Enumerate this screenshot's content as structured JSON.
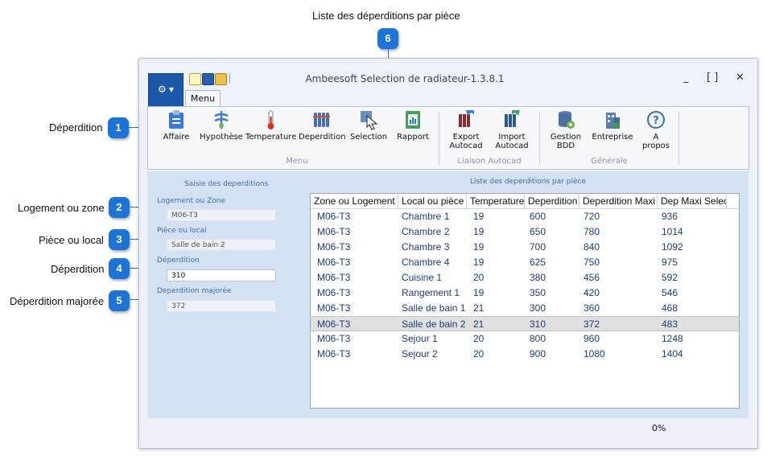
{
  "annotations": {
    "top_label": "Liste des déperditions par pièce",
    "items": [
      {
        "number": "1",
        "label": "Déperdition"
      },
      {
        "number": "2",
        "label": "Logement ou zone"
      },
      {
        "number": "3",
        "label": "Pièce ou local"
      },
      {
        "number": "4",
        "label": "Déperdition"
      },
      {
        "number": "5",
        "label": "Déperdition majorée"
      },
      {
        "number": "6"
      }
    ]
  },
  "window": {
    "title": "Ambeesoft Selection de radiateur-1.3.8.1",
    "controls": {
      "minimize": "_",
      "maximize": "[ ]",
      "close": "✕"
    },
    "tab": "Menu"
  },
  "ribbon": {
    "groups": [
      {
        "label": "Menu",
        "buttons": [
          {
            "label": "Affaire",
            "icon": "clipboard-icon"
          },
          {
            "label": "Hypothèse",
            "icon": "hypothesis-icon"
          },
          {
            "label": "Temperature",
            "icon": "thermometer-icon"
          },
          {
            "label": "Deperdition",
            "icon": "radiator-icon"
          },
          {
            "label": "Selection",
            "icon": "selection-cursor-icon"
          },
          {
            "label": "Rapport",
            "icon": "report-icon"
          }
        ]
      },
      {
        "label": "Liaison Autocad",
        "buttons": [
          {
            "label": "Export Autocad",
            "line1": "Export",
            "line2": "Autocad",
            "icon": "export-autocad-icon"
          },
          {
            "label": "Import Autocad",
            "line1": "Import",
            "line2": "Autocad",
            "icon": "import-autocad-icon"
          }
        ]
      },
      {
        "label": "Générale",
        "buttons": [
          {
            "label": "Gestion BDD",
            "line1": "Gestion",
            "line2": "BDD",
            "icon": "database-gear-icon"
          },
          {
            "label": "Entreprise",
            "icon": "building-icon"
          },
          {
            "label": "A propos",
            "line1": "A",
            "line2": "propos",
            "icon": "help-icon"
          }
        ]
      }
    ]
  },
  "left_pane": {
    "title": "Saisie des deperditions",
    "fields": [
      {
        "label": "Logement ou Zone",
        "value": "M06-T3"
      },
      {
        "label": "Pièce ou local",
        "value": "Salle de bain 2"
      },
      {
        "label": "Déperdition",
        "value": "310"
      },
      {
        "label": "Deperdition majorée",
        "value": "372"
      }
    ]
  },
  "right_pane": {
    "title": "Liste des deperditions par pièce",
    "columns": [
      "Zone ou Logement",
      "Local ou pièce",
      "Temperature",
      "Deperdition",
      "Deperdition Maxi",
      "Dep Maxi Selec"
    ],
    "rows": [
      [
        "M06-T3",
        "Chambre 1",
        "19",
        "600",
        "720",
        "936"
      ],
      [
        "M06-T3",
        "Chambre 2",
        "19",
        "650",
        "780",
        "1014"
      ],
      [
        "M06-T3",
        "Chambre 3",
        "19",
        "700",
        "840",
        "1092"
      ],
      [
        "M06-T3",
        "Chambre 4",
        "19",
        "625",
        "750",
        "975"
      ],
      [
        "M06-T3",
        "Cuisine 1",
        "20",
        "380",
        "456",
        "592"
      ],
      [
        "M06-T3",
        "Rangement 1",
        "19",
        "350",
        "420",
        "546"
      ],
      [
        "M06-T3",
        "Salle de bain 1",
        "21",
        "300",
        "360",
        "468"
      ],
      [
        "M06-T3",
        "Salle de bain 2",
        "21",
        "310",
        "372",
        "483"
      ],
      [
        "M06-T3",
        "Sejour 1",
        "20",
        "800",
        "960",
        "1248"
      ],
      [
        "M06-T3",
        "Sejour 2",
        "20",
        "900",
        "1080",
        "1404"
      ]
    ],
    "selected_row": 7
  },
  "status": {
    "progress": "0%"
  },
  "colors": {
    "accent": "#1d74d6",
    "app_button": "#1b59a8",
    "grid_text": "#1f3d7a",
    "pane_label": "#3c6ea8"
  }
}
